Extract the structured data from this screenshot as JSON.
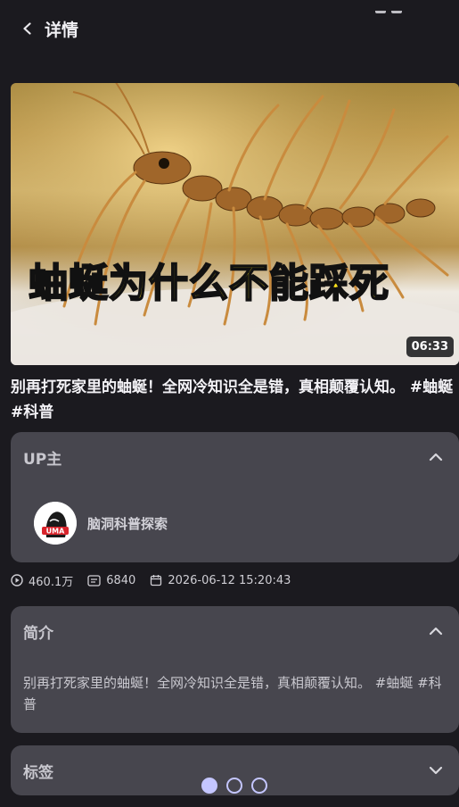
{
  "header": {
    "title": "详情"
  },
  "video": {
    "caption_red": "蚰蜒",
    "caption_yellow": "为什么不能踩死",
    "duration": "06:33",
    "title": "别再打死家里的蚰蜒！全网冷知识全是错，真相颠覆认知。 #蚰蜒 #科普"
  },
  "up_section": {
    "title": "UP主",
    "uploader_name": "脑洞科普探索",
    "avatar_text": "UMA"
  },
  "stats": {
    "views": "460.1万",
    "danmaku": "6840",
    "date": "2026-06-12 15:20:43"
  },
  "intro_section": {
    "title": "简介",
    "text": "别再打死家里的蚰蜒！全网冷知识全是错，真相颠覆认知。 #蚰蜒 #科普"
  },
  "tags_section": {
    "title": "标签"
  },
  "pager": {
    "count": 3,
    "active": 0
  },
  "colors": {
    "background": "#1b1a1f",
    "card": "#47464e",
    "accent": "#c4c6ff"
  }
}
